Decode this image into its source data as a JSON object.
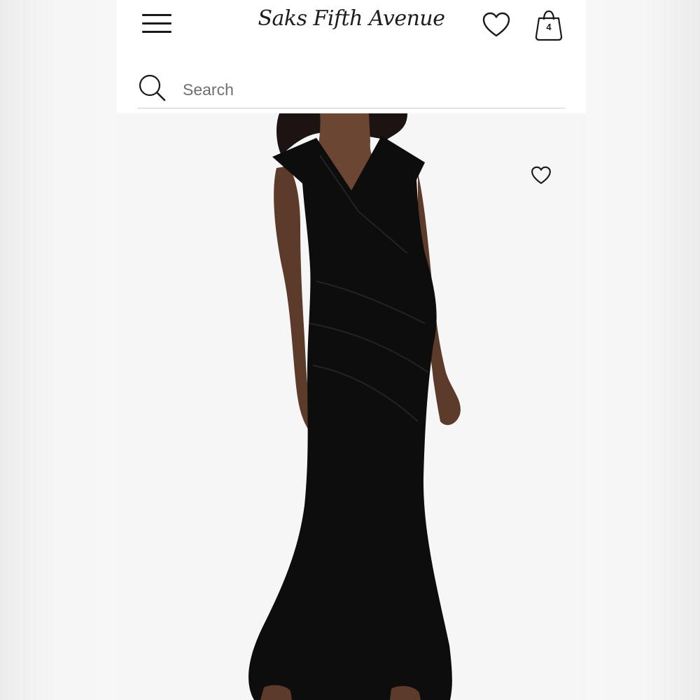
{
  "header": {
    "brand": "Saks Fifth Avenue",
    "menu_icon": "hamburger-menu-icon",
    "wishlist_icon": "heart-icon",
    "bag_icon": "shopping-bag-icon",
    "bag_count": "4"
  },
  "search": {
    "icon": "search-icon",
    "placeholder": "Search"
  },
  "product": {
    "wishlist_icon": "heart-icon"
  },
  "colors": {
    "text": "#1a1a1a",
    "divider": "#cfcfcf",
    "background": "#ffffff",
    "dress": "#0d0d0d"
  }
}
